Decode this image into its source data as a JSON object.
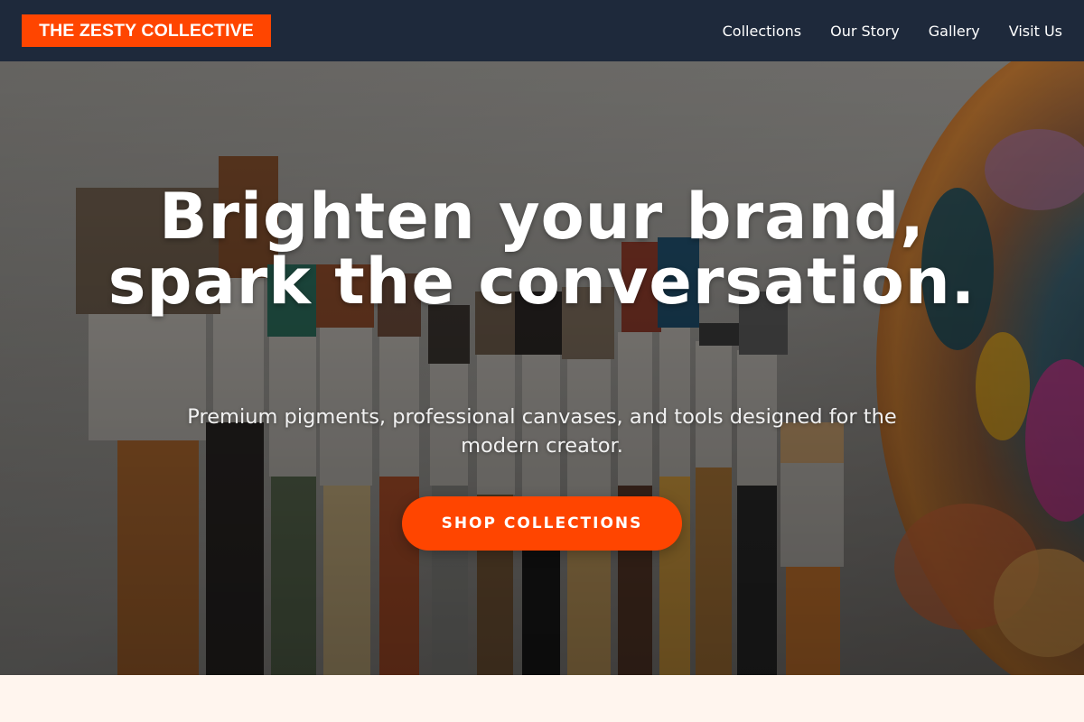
{
  "brand": {
    "logo_text": "THE ZESTY COLLECTIVE",
    "accent_color": "#ff4500",
    "nav_background": "#1e293b"
  },
  "nav": {
    "links": [
      {
        "label": "Collections"
      },
      {
        "label": "Our Story"
      },
      {
        "label": "Gallery"
      },
      {
        "label": "Visit Us"
      }
    ]
  },
  "hero": {
    "headline": "Brighten your brand, spark the conversation.",
    "subheadline": "Premium pigments, professional canvases, and tools designed for the modern creator.",
    "cta_label": "SHOP COLLECTIONS",
    "background_image": "paintbrushes-and-palette-photo"
  },
  "page": {
    "below_fold_background": "#fff5ee"
  }
}
